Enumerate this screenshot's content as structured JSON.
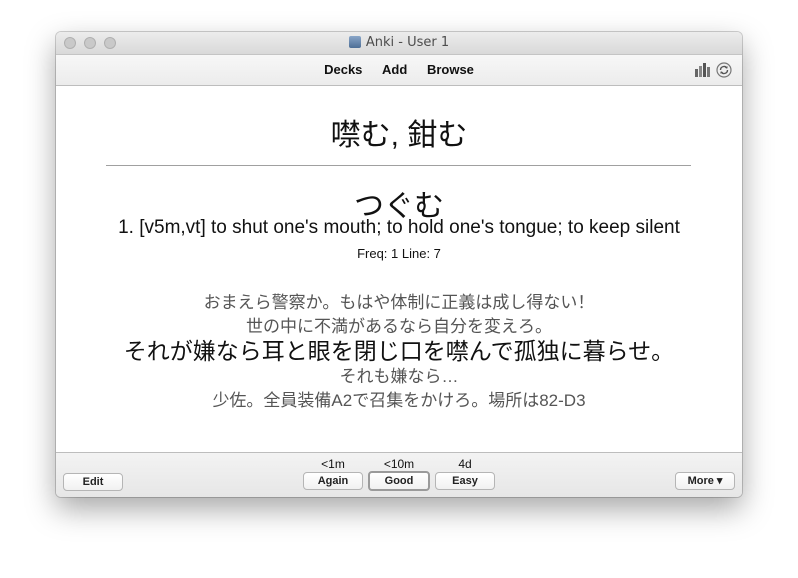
{
  "window": {
    "title": "Anki - User 1"
  },
  "toolbar": {
    "decks": "Decks",
    "add": "Add",
    "browse": "Browse"
  },
  "card": {
    "front": "噤む, 鉗む",
    "reading": "つぐむ",
    "meaning": "1. [v5m,vt] to shut one's mouth; to hold one's tongue; to keep silent",
    "freq": "Freq: 1 Line: 7",
    "example_lines": [
      "おまえら警察か。もはや体制に正義は成し得ない！",
      "世の中に不満があるなら自分を変えろ。",
      "それが嫌なら耳と眼を閉じ口を噤んで孤独に暮らせ。",
      "それも嫌なら…",
      "少佐。全員装備A2で召集をかけろ。場所は82-D3"
    ]
  },
  "bottom": {
    "edit": "Edit",
    "more": "More ▾",
    "answers": [
      {
        "interval": "<1m",
        "label": "Again"
      },
      {
        "interval": "<10m",
        "label": "Good"
      },
      {
        "interval": "4d",
        "label": "Easy"
      }
    ]
  }
}
